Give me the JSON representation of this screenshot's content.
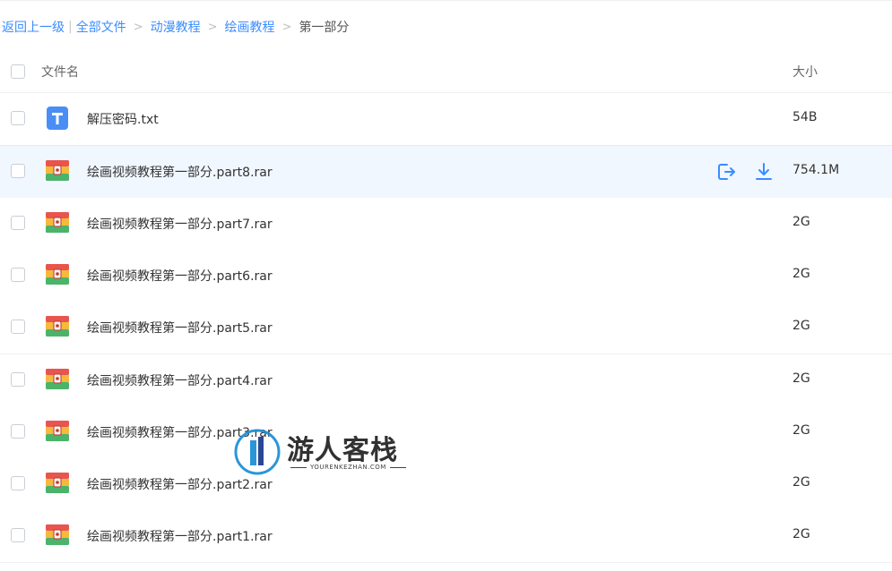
{
  "breadcrumb": {
    "back": "返回上一级",
    "all_files": "全部文件",
    "level1": "动漫教程",
    "level2": "绘画教程",
    "current": "第一部分",
    "separator": ">"
  },
  "table": {
    "header": {
      "name": "文件名",
      "size": "大小"
    },
    "rows": [
      {
        "name": "解压密码.txt",
        "size": "54B",
        "type": "txt"
      },
      {
        "name": "绘画视频教程第一部分.part8.rar",
        "size": "754.1M",
        "type": "rar"
      },
      {
        "name": "绘画视频教程第一部分.part7.rar",
        "size": "2G",
        "type": "rar"
      },
      {
        "name": "绘画视频教程第一部分.part6.rar",
        "size": "2G",
        "type": "rar"
      },
      {
        "name": "绘画视频教程第一部分.part5.rar",
        "size": "2G",
        "type": "rar"
      },
      {
        "name": "绘画视频教程第一部分.part4.rar",
        "size": "2G",
        "type": "rar"
      },
      {
        "name": "绘画视频教程第一部分.part3.rar",
        "size": "2G",
        "type": "rar"
      },
      {
        "name": "绘画视频教程第一部分.part2.rar",
        "size": "2G",
        "type": "rar"
      },
      {
        "name": "绘画视频教程第一部分.part1.rar",
        "size": "2G",
        "type": "rar"
      }
    ],
    "hover_row_index": 1
  },
  "icons": {
    "txt": "text-file-icon",
    "rar": "archive-file-icon",
    "share": "share-icon",
    "download": "download-icon"
  },
  "watermark": {
    "title": "游人客栈",
    "subtitle": "YOURENKEZHAN.COM"
  },
  "colors": {
    "link": "#3b8cff",
    "hover_row": "#f1f7ff",
    "txt_icon": "#4a8ef5"
  }
}
